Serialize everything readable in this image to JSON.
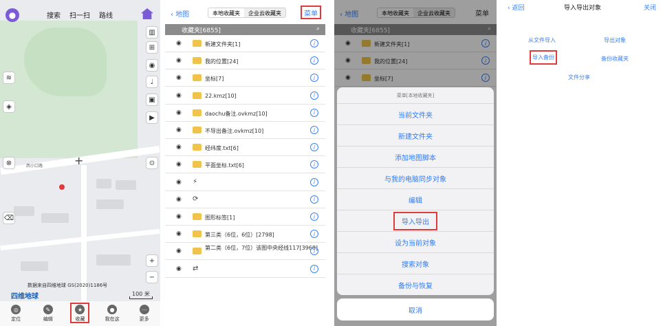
{
  "map_screen": {
    "nav": [
      "搜索",
      "扫一扫",
      "路线"
    ],
    "road_label": "西小口路",
    "attribution": "数据来自四维地球 GS(2020)1186号",
    "logo": "四维地球",
    "scale": "100 米",
    "zoom_in": "+",
    "zoom_out": "−",
    "tabs": [
      "定位",
      "编辑",
      "收藏",
      "我在这",
      "更多"
    ],
    "highlighted_tab": "收藏"
  },
  "favorites_screen": {
    "back_label": "地图",
    "segments": [
      "本地收藏夹",
      "企业云收藏夹"
    ],
    "active_segment": "本地收藏夹",
    "menu_label": "菜单",
    "header": "收藏夹[6855]",
    "items": [
      {
        "kind": "folder",
        "name": "新建文件夹[1]"
      },
      {
        "kind": "folder",
        "name": "我的位置[24]"
      },
      {
        "kind": "folder",
        "name": "坐标[7]"
      },
      {
        "kind": "folder",
        "name": "22.kmz[10]"
      },
      {
        "kind": "folder",
        "name": "daochu备注.ovkmz[10]"
      },
      {
        "kind": "folder",
        "name": "不导出备注.ovkmz[10]"
      },
      {
        "kind": "folder",
        "name": "经纬度.txt[6]"
      },
      {
        "kind": "folder",
        "name": "平面坐标.txt[6]"
      },
      {
        "kind": "glyph",
        "name": ""
      },
      {
        "kind": "glyph",
        "name": ""
      },
      {
        "kind": "folder",
        "name": "图形标签[1]"
      },
      {
        "kind": "folder",
        "name": "第三类（6位，6位）[2798]"
      },
      {
        "kind": "folder",
        "name": "第二类（6位，7位）该图中央经线117[3968]"
      },
      {
        "kind": "glyph",
        "name": ""
      }
    ]
  },
  "menu_sheet": {
    "title": "菜单[本地收藏夹]",
    "items": [
      "当前文件夹",
      "新建文件夹",
      "添加地图脚本",
      "与我的电脑同步对象",
      "编辑",
      "导入导出",
      "设为当前对象",
      "搜索对象",
      "备份与恢复"
    ],
    "highlighted": "导入导出",
    "cancel": "取消",
    "background_rows": [
      "新建文件夹[1]",
      "我的位置[24]",
      "坐标[7]"
    ]
  },
  "import_export_screen": {
    "back_label": "返回",
    "title": "导入导出对象",
    "close_label": "关闭",
    "options": [
      "从文件导入",
      "导出对象",
      "导入备份",
      "备份收藏夹",
      "文件分享"
    ],
    "highlighted": "导入备份"
  },
  "colors": {
    "accent": "#3b82f6",
    "highlight": "#e03a3a",
    "folder": "#f0c34c",
    "header_bar": "#8b8b8b"
  }
}
